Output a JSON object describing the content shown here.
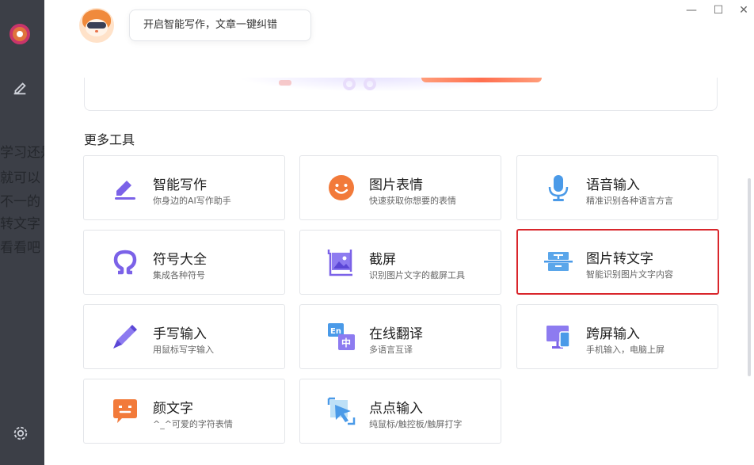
{
  "background": {
    "fragments": [
      "学习还是",
      "就可以",
      "不一的",
      "转文字",
      "看看吧"
    ]
  },
  "header": {
    "bubble_text": "开启智能写作，文章一键纠错",
    "controls": {
      "minimize": "—",
      "maximize": "☐",
      "close": "✕"
    }
  },
  "section": {
    "title": "更多工具"
  },
  "tools": [
    {
      "name": "智能写作",
      "desc": "你身边的AI写作助手",
      "icon": "pen-write-icon"
    },
    {
      "name": "图片表情",
      "desc": "快速获取你想要的表情",
      "icon": "smiley-icon"
    },
    {
      "name": "语音输入",
      "desc": "精准识别各种语言方言",
      "icon": "microphone-icon"
    },
    {
      "name": "符号大全",
      "desc": "集成各种符号",
      "icon": "omega-icon"
    },
    {
      "name": "截屏",
      "desc": "识别图片文字的截屏工具",
      "icon": "screenshot-icon"
    },
    {
      "name": "图片转文字",
      "desc": "智能识别图片文字内容",
      "icon": "ocr-scan-icon"
    },
    {
      "name": "手写输入",
      "desc": "用鼠标写字输入",
      "icon": "handwriting-pen-icon"
    },
    {
      "name": "在线翻译",
      "desc": "多语言互译",
      "icon": "translate-icon"
    },
    {
      "name": "跨屏输入",
      "desc": "手机输入，电脑上屏",
      "icon": "cross-screen-icon"
    },
    {
      "name": "颜文字",
      "desc": "^_^可爱的字符表情",
      "icon": "kaomoji-icon"
    },
    {
      "name": "点点输入",
      "desc": "纯鼠标/触控板/触屏打字",
      "icon": "cursor-click-icon"
    }
  ],
  "colors": {
    "highlight_border": "#d9262c",
    "icon_purple": "#7b62e8",
    "icon_orange": "#f27a3a",
    "icon_blue": "#4a9ae8"
  }
}
